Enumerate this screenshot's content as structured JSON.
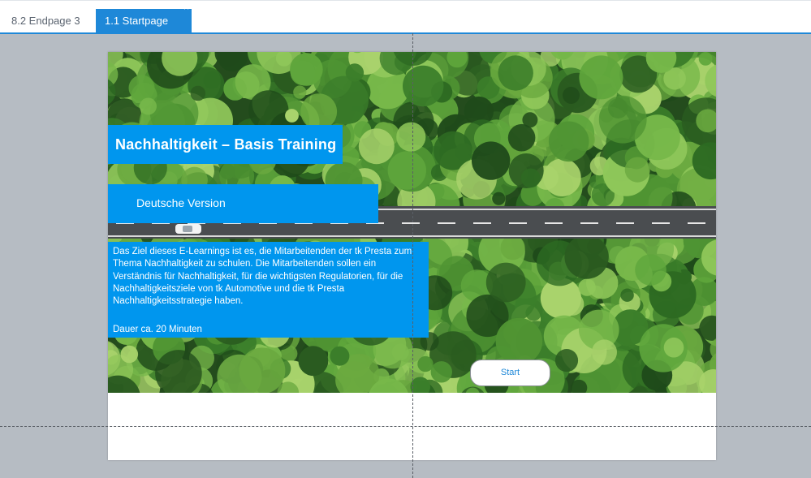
{
  "tabs": [
    {
      "label": "8.2 Endpage 3",
      "active": false
    },
    {
      "label": "1.1 Startpage",
      "active": true,
      "close_glyph": "×"
    }
  ],
  "slide": {
    "title": "Nachhaltigkeit – Basis Training",
    "subtitle": "Deutsche Version",
    "description": "Das Ziel dieses E-Learnings ist es, die Mitarbeitenden der tk Presta zum Thema Nachhaltigkeit zu schulen. Die Mitarbeitenden sollen ein Verständnis für Nachhaltigkeit, für die wichtigsten Regulatorien, für die Nachhaltigkeitsziele von tk Automotive und die tk Presta Nachhaltigkeitsstrategie haben.",
    "duration": "Dauer ca. 20 Minuten",
    "start_label": "Start",
    "hero_image": "aerial-forest-road-with-car"
  },
  "colors": {
    "accent": "#0096ee",
    "tab_active": "#1e88d8",
    "canvas": "#b6bcc3"
  }
}
